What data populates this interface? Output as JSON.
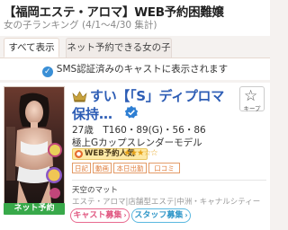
{
  "header": {
    "title": "【福岡エステ・アロマ】WEB予約困難嬢",
    "subtitle": "女の子ランキング (4/1～4/30 集計)"
  },
  "tabs": [
    {
      "label": "すべて表示",
      "active": true
    },
    {
      "label": "ネット予約できる女の子",
      "active": false
    }
  ],
  "notice": {
    "icon": "check-circle-icon",
    "text": "SMS認証済みのキャストに表示されます"
  },
  "card": {
    "rank_icon": "crown-icon",
    "name_line1": "すい【「S」ディプロマ",
    "name_line2": "保持…",
    "verified_icon": "verified-badge-icon",
    "keep": {
      "icon": "star-outline-icon",
      "label": "キープ"
    },
    "stats": "27歳　T160・89(G)・56・86",
    "catchphrase": "極上Gカップスレンダーモデル",
    "popularity": {
      "label": "WEB予約人気",
      "stars": 3,
      "max_stars": 5
    },
    "tags": [
      "日記",
      "動画",
      "本日出勤",
      "口コミ"
    ],
    "shop_name": "天空のマット",
    "shop_area": "エステ・アロマ|店舗型エステ|中洲・キャナルシティー",
    "reserve_label": "ネット予約",
    "recruit_buttons": [
      {
        "label": "キャスト募集"
      },
      {
        "label": "スタッフ募集"
      }
    ]
  },
  "colors": {
    "link_blue": "#2d5db5",
    "reserve_green": "#38a94a",
    "tag_orange": "#e07d3b",
    "cast_pink": "#e0557f",
    "staff_blue": "#2f96c8",
    "badge_yellow": "#fde9a6"
  }
}
